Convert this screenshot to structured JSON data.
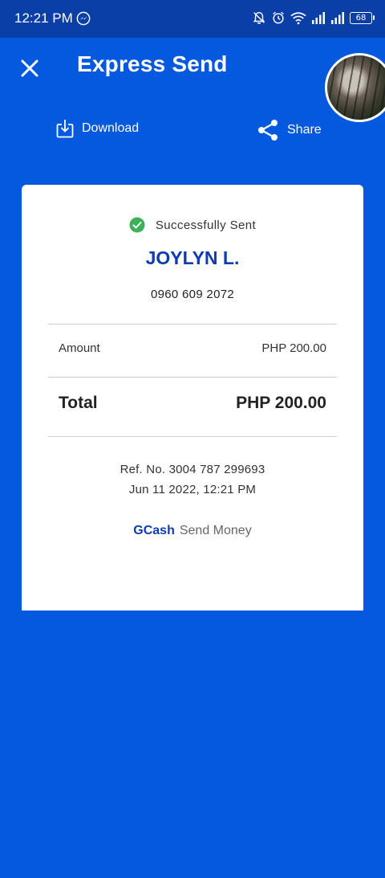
{
  "status_bar": {
    "time": "12:21 PM",
    "battery": "68",
    "icons": [
      "messenger-icon",
      "bell-off-icon",
      "alarm-icon",
      "wifi-icon",
      "signal-icon",
      "signal-icon",
      "battery-icon"
    ]
  },
  "header": {
    "title": "Express Send",
    "close_icon": "close-icon"
  },
  "actions": {
    "download_label": "Download",
    "share_label": "Share"
  },
  "receipt": {
    "status": "Successfully Sent",
    "recipient_name": "JOYLYN L.",
    "recipient_number": "0960 609 2072",
    "amount_label": "Amount",
    "amount_value": "PHP 200.00",
    "total_label": "Total",
    "total_value": "PHP 200.00",
    "ref_no": "Ref. No. 3004 787 299693",
    "datetime": "Jun 11 2022, 12:21 PM",
    "brand": "GCash",
    "brand_subtitle": "Send Money"
  },
  "colors": {
    "background": "#0459DE",
    "status_bar": "#0A3FA8",
    "brand_blue": "#0D3CB0",
    "success_green": "#3DB05A"
  }
}
